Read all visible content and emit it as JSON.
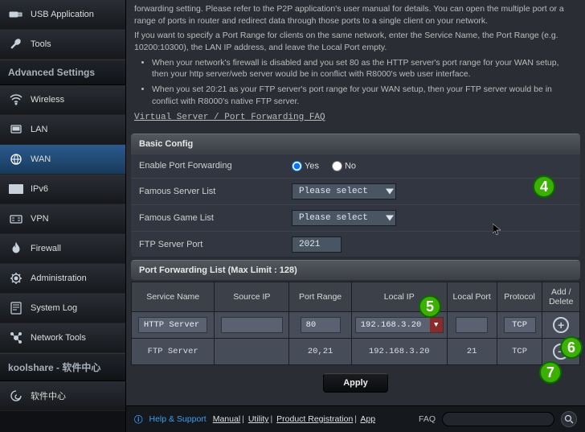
{
  "sidebar": {
    "top": [
      {
        "label": "USB Application",
        "icon": "usb"
      },
      {
        "label": "Tools",
        "icon": "wrench"
      }
    ],
    "advanced_header": "Advanced Settings",
    "advanced": [
      {
        "label": "Wireless",
        "icon": "wifi"
      },
      {
        "label": "LAN",
        "icon": "lan"
      },
      {
        "label": "WAN",
        "icon": "globe",
        "active": true
      },
      {
        "label": "IPv6",
        "icon": "ipv6"
      },
      {
        "label": "VPN",
        "icon": "vpn"
      },
      {
        "label": "Firewall",
        "icon": "fire"
      },
      {
        "label": "Administration",
        "icon": "gear"
      },
      {
        "label": "System Log",
        "icon": "log"
      },
      {
        "label": "Network Tools",
        "icon": "nettools"
      }
    ],
    "koolshare_header": "koolshare - 软件中心",
    "koolshare": [
      {
        "label": "软件中心",
        "icon": "swirl"
      }
    ]
  },
  "intro": {
    "p1": "forwarding setting. Please refer to the P2P application's user manual for details. You can open the multiple port or a range of ports in router and redirect data through those ports to a single client on your network.",
    "p2": "If you want to specify a Port Range for clients on the same network, enter the Service Name, the Port Range (e.g. 10200:10300), the LAN IP address, and leave the Local Port empty.",
    "li1": "When your network's firewall is disabled and you set 80 as the HTTP server's port range for your WAN setup, then your http server/web server would be in conflict with R8000's web user interface.",
    "li2": "When you set 20:21 as your FTP server's port range for your WAN setup, then your FTP server would be in conflict with R8000's native FTP server.",
    "faq": "Virtual Server / Port Forwarding FAQ"
  },
  "basic": {
    "header": "Basic Config",
    "enable_label": "Enable Port Forwarding",
    "yes": "Yes",
    "no": "No",
    "famous_server_label": "Famous Server List",
    "famous_server_value": "Please select",
    "famous_game_label": "Famous Game List",
    "famous_game_value": "Please select",
    "ftp_port_label": "FTP Server Port",
    "ftp_port_value": "2021"
  },
  "pflist": {
    "header": "Port Forwarding List (Max Limit : 128)",
    "cols": {
      "service": "Service Name",
      "source": "Source IP",
      "portrange": "Port Range",
      "localip": "Local IP",
      "localport": "Local Port",
      "protocol": "Protocol",
      "action": "Add / Delete"
    },
    "rows": [
      {
        "service": "HTTP Server",
        "source": "",
        "portrange": "80",
        "localip": "192.168.3.20",
        "localport": "",
        "protocol": "TCP",
        "action": "add"
      },
      {
        "service": "FTP Server",
        "source": "",
        "portrange": "20,21",
        "localip": "192.168.3.20",
        "localport": "21",
        "protocol": "TCP",
        "action": "del"
      }
    ]
  },
  "apply": "Apply",
  "footer": {
    "help": "Help & Support",
    "manual": "Manual",
    "utility": "Utility",
    "reg": "Product Registration",
    "app": "App",
    "faq": "FAQ"
  },
  "badges": {
    "b4": "4",
    "b5": "5",
    "b6": "6",
    "b7": "7"
  }
}
